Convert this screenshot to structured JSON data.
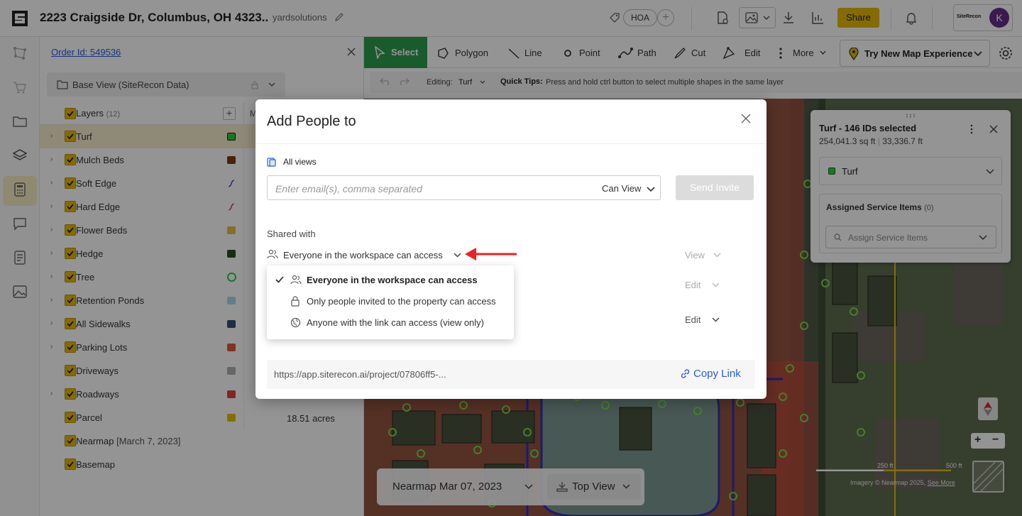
{
  "header": {
    "address": "2223 Craigside Dr, Columbus, OH 4323..",
    "workspace": "yardsolutions",
    "tag": "HOA",
    "share_label": "Share",
    "brand_name": "SiteRecon",
    "avatar_initial": "K",
    "accent_color": "#e5b800"
  },
  "panel": {
    "order_id": "Order Id: 549536",
    "base_view": "Base View (SiteRecon Data)",
    "layers_title": "Layers",
    "layers_count": "(12)",
    "col_m": "M",
    "layers": [
      {
        "name": "Turf",
        "swatch": "#2ecc40",
        "selected": true,
        "expandable": true
      },
      {
        "name": "Mulch Beds",
        "swatch": "#7a3b12",
        "expandable": true
      },
      {
        "name": "Soft Edge",
        "swatch": "#2a2ad0",
        "expandable": true
      },
      {
        "name": "Hard Edge",
        "swatch": "#d02a2a",
        "expandable": true
      },
      {
        "name": "Flower Beds",
        "swatch": "#e5c04a",
        "expandable": true
      },
      {
        "name": "Hedge",
        "swatch": "#2e4a28",
        "expandable": true
      },
      {
        "name": "Tree",
        "swatch": "#2ecc40",
        "expandable": true
      },
      {
        "name": "Retention Ponds",
        "swatch": "#a9d8ee",
        "expandable": true
      },
      {
        "name": "All Sidewalks",
        "swatch": "#34507a",
        "expandable": true
      },
      {
        "name": "Parking Lots",
        "swatch": "#e05a3a",
        "expandable": true
      },
      {
        "name": "Driveways",
        "swatch": "#b0b0b0",
        "expandable": false
      },
      {
        "name": "Roadways",
        "swatch": "#e04040",
        "expandable": true
      },
      {
        "name": "Parcel",
        "swatch": "#e5c000",
        "expandable": false,
        "value": "18.51 acres"
      },
      {
        "name": "Nearmap",
        "sub": "[March 7, 2023]",
        "expandable": false
      },
      {
        "name": "Basemap",
        "expandable": false
      }
    ]
  },
  "map_toolbar": {
    "tools": [
      "Select",
      "Polygon",
      "Line",
      "Point",
      "Path",
      "Cut",
      "Edit",
      "More"
    ],
    "try_new": "Try New Map Experience",
    "editing_label": "Editing:",
    "editing_layer": "Turf",
    "quick_tips_label": "Quick Tips:",
    "quick_tips": "Press and hold ctrl button to select multiple shapes in the same layer"
  },
  "selection_card": {
    "title": "Turf - 146 IDs selected",
    "area": "254,041.3 sq ft",
    "perimeter": "33,336.7 ft",
    "layer": "Turf",
    "assigned_title": "Assigned Service Items",
    "assigned_count": "(0)",
    "assign_placeholder": "Assign Service Items"
  },
  "map": {
    "date": "Nearmap Mar 07, 2023",
    "view": "Top View",
    "scale_mid": "250 ft",
    "scale_end": "500 ft",
    "attribution": "Imagery © Nearmap 2025,",
    "attribution_link": "See More"
  },
  "modal": {
    "title": "Add People to",
    "views_label": "All views",
    "email_placeholder": "Enter email(s), comma separated",
    "permission": "Can View",
    "send_label": "Send Invite",
    "shared_with": "Shared with",
    "access_selected": "Everyone in the workspace can access",
    "row1_perm": "View",
    "row2_perm": "Edit",
    "row3_perm": "Edit",
    "link": "https://app.siterecon.ai/project/07806ff5-...",
    "copy_label": "Copy Link"
  },
  "dropdown": {
    "options": [
      {
        "label": "Everyone in the workspace can access",
        "icon": "users-icon",
        "checked": true
      },
      {
        "label": "Only people invited to the property can access",
        "icon": "lock-icon",
        "checked": false
      },
      {
        "label": "Anyone with the link can access (view only)",
        "icon": "globe-icon",
        "checked": false
      }
    ]
  }
}
